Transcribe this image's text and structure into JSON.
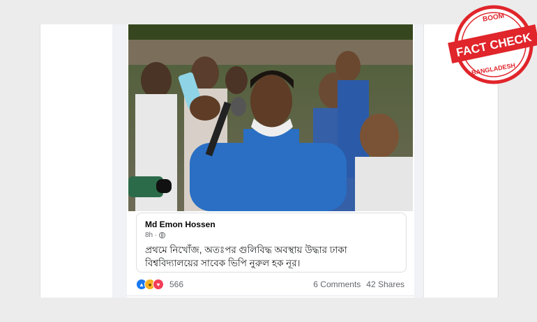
{
  "post": {
    "author": "Md Emon Hossen",
    "time": "8h ·",
    "text": "প্রথমে নিখোঁজ, অতঃপর গুলিবিদ্ধ অবস্থায় উদ্ধার ঢাকা বিশ্ববিদ্যালয়ের সাবেক ভিপি নুরুল হক নূর।"
  },
  "reactions": {
    "count": "566",
    "icons": [
      "like-icon",
      "sad-icon",
      "love-icon"
    ]
  },
  "stats": {
    "comments": "6 Comments",
    "shares": "42 Shares"
  },
  "badge": {
    "top": "BOOM",
    "main": "FACT CHECK",
    "bottom": "BANGLADESH"
  },
  "colors": {
    "badge_red": "#e0252b",
    "fb_blue": "#1877f2",
    "shirt_blue": "#2a6fc4"
  }
}
